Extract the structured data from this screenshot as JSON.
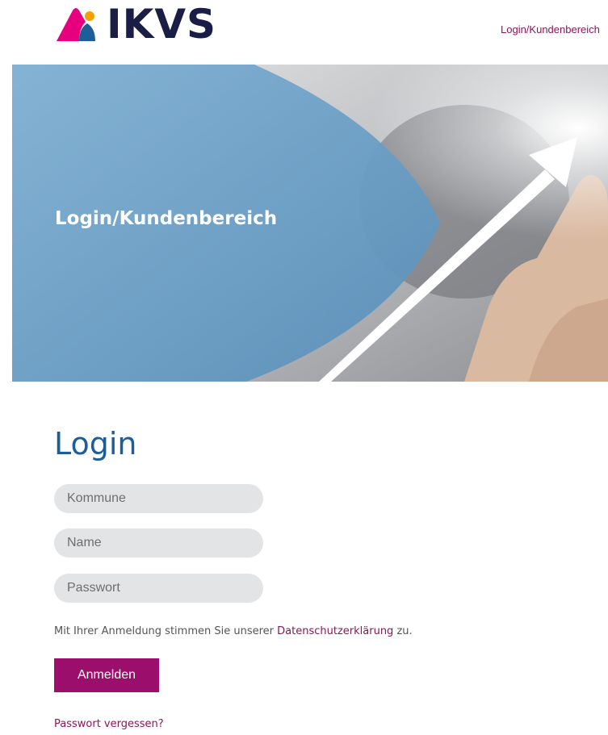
{
  "header": {
    "logo_text": "IKVS",
    "nav_link": "Login/Kundenbereich"
  },
  "hero": {
    "title": "Login/Kundenbereich"
  },
  "form": {
    "heading": "Login",
    "fields": {
      "kommune_placeholder": "Kommune",
      "name_placeholder": "Name",
      "password_placeholder": "Passwort"
    },
    "consent_prefix": "Mit Ihrer Anmeldung stimmen Sie unserer ",
    "consent_link": "Datenschutzerklärung",
    "consent_suffix": " zu.",
    "submit_label": "Anmelden",
    "forgot_label": "Passwort vergessen?"
  },
  "colors": {
    "brand_magenta": "#9b0e6b",
    "link": "#8a1659",
    "heading_blue": "#1e5e96",
    "hero_blue": "#6e9fc4",
    "logo_navy": "#1a1d46"
  }
}
